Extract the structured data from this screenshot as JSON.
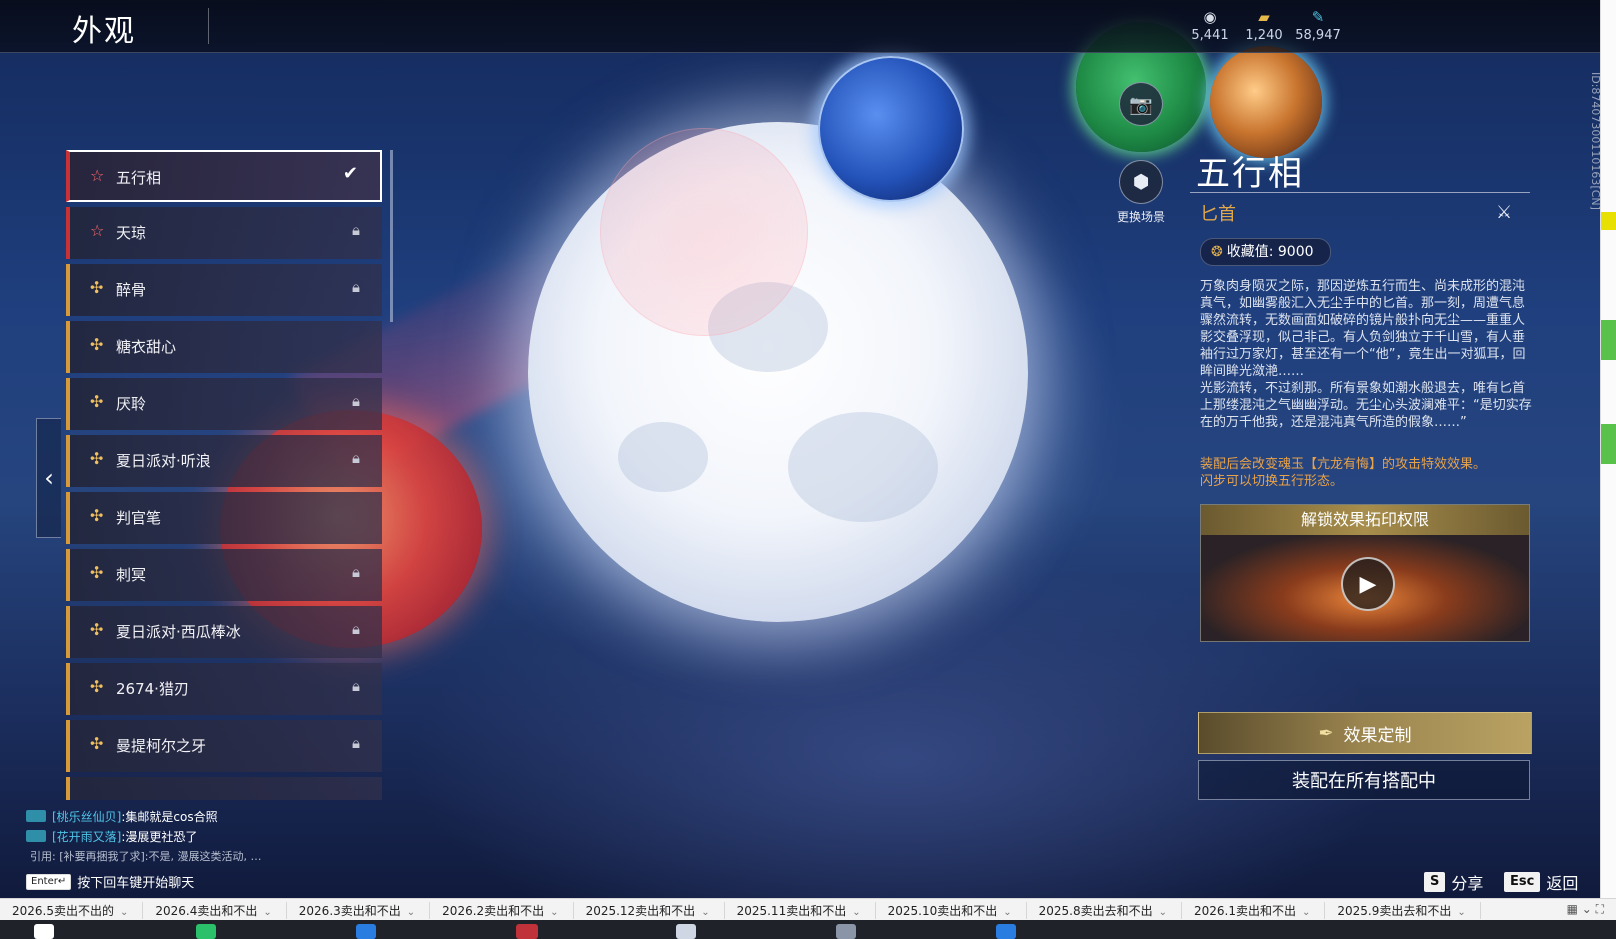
{
  "header": {
    "title": "外观"
  },
  "currencies": [
    {
      "icon": "spirit-coin-icon",
      "value": "5,441"
    },
    {
      "icon": "gold-ingot-icon",
      "value": "1,240"
    },
    {
      "icon": "feather-icon",
      "value": "58,947"
    }
  ],
  "scene_buttons": {
    "photo_label": "",
    "change_scene_label": "更换场景"
  },
  "list": {
    "items": [
      {
        "name": "五行相",
        "tier": "red",
        "state": "selected"
      },
      {
        "name": "天琼",
        "tier": "red",
        "state": "locked"
      },
      {
        "name": "醉骨",
        "tier": "gold",
        "state": "locked"
      },
      {
        "name": "糖衣甜心",
        "tier": "gold",
        "state": "none"
      },
      {
        "name": "厌聆",
        "tier": "gold",
        "state": "locked"
      },
      {
        "name": "夏日派对·听浪",
        "tier": "gold",
        "state": "locked"
      },
      {
        "name": "判官笔",
        "tier": "gold",
        "state": "none"
      },
      {
        "name": "刺冥",
        "tier": "gold",
        "state": "locked"
      },
      {
        "name": "夏日派对·西瓜棒冰",
        "tier": "gold",
        "state": "locked"
      },
      {
        "name": "2674·猎刃",
        "tier": "gold",
        "state": "locked"
      },
      {
        "name": "曼提柯尔之牙",
        "tier": "gold",
        "state": "locked"
      }
    ]
  },
  "detail": {
    "title": "五行相",
    "weapon": "匕首",
    "collect_label": "收藏值: 9000",
    "description": [
      "万象肉身陨灭之际，那因逆炼五行而生、尚未成形的混沌真气，如幽雾般汇入无尘手中的匕首。那一刻，周遭气息骤然流转，无数画面如破碎的镜片般扑向无尘——重重人影交叠浮现，似己非己。有人负剑独立于千山雪，有人垂袖行过万家灯，甚至还有一个“他”，竟生出一对狐耳，回眸间眸光潋滟……",
      "光影流转，不过刹那。所有景象如潮水般退去，唯有匕首上那缕混沌之气幽幽浮动。无尘心头波澜难平：“是切实存在的万千他我，还是混沌真气所造的假象……”"
    ],
    "note": [
      "装配后会改变魂玉【亢龙有悔】的攻击特效效果。",
      "闪步可以切换五行形态。"
    ],
    "unlock_title": "解锁效果拓印权限",
    "custom_button": "效果定制",
    "equip_button": "装配在所有搭配中",
    "side_id": "ID:8740730011​0163[CN]"
  },
  "chat": {
    "lines": [
      {
        "badge": "",
        "name": "[桃乐丝仙贝]",
        "text": ":集邮就是cos合照"
      },
      {
        "badge": "",
        "name": "[花开雨又落]",
        "text": ":漫展更社恐了"
      }
    ],
    "quote": "引用: [补要再捆我了求]:不是, 漫展这类活动, …",
    "enter_key": "Enter↵",
    "enter_hint": "按下回车键开始聊天"
  },
  "hints": {
    "share_key": "S",
    "share_label": "分享",
    "back_key": "Esc",
    "back_label": "返回"
  },
  "bookmarks": [
    "2026.5卖出不出的",
    "2026.4卖出和不出",
    "2026.3卖出和不出",
    "2026.2卖出和不出",
    "2025.12卖出和不出",
    "2025.11卖出和不出",
    "2025.10卖出和不出",
    "2025.8卖出去和不出",
    "2026.1卖出和不出",
    "2025.9卖出去和不出"
  ]
}
